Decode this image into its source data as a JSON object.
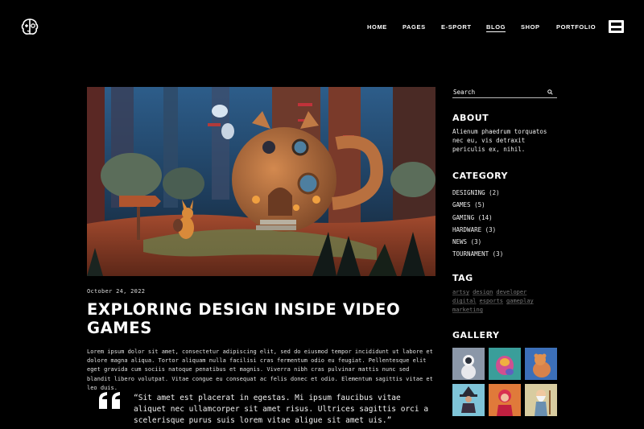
{
  "header": {
    "logo_icon": "brain-icon",
    "nav": [
      {
        "label": "HOME"
      },
      {
        "label": "PAGES"
      },
      {
        "label": "E-SPORT"
      },
      {
        "label": "BLOG",
        "active": true
      },
      {
        "label": "SHOP"
      },
      {
        "label": "PORTFOLIO"
      }
    ],
    "menu_icon": "hamburger-menu-icon"
  },
  "post": {
    "image_icon": "cartoon-fox-house-scene",
    "date": "October 24, 2022",
    "title": "EXPLORING DESIGN INSIDE VIDEO GAMES",
    "body": "Lorem ipsum dolor sit amet, consectetur adipiscing elit, sed do eiusmod tempor incididunt ut labore et dolore magna aliqua. Tortor aliquam nulla facilisi cras fermentum odio eu feugiat. Pellentesque elit eget gravida cum sociis natoque penatibus et magnis. Viverra nibh cras pulvinar mattis nunc sed blandit libero volutpat. Vitae congue eu consequat ac felis donec et odio. Elementum sagittis vitae et leo duis.",
    "quote": "“Sit amet est placerat in egestas. Mi ipsum faucibus vitae aliquet nec ullamcorper sit amet risus. Ultrices sagittis orci a scelerisque purus suis lorem vitae aligue sit amet uis.”"
  },
  "sidebar": {
    "search": {
      "placeholder": "Search",
      "icon": "search-icon"
    },
    "about": {
      "heading": "ABOUT",
      "text": "Alienum phaedrum torquatos nec eu, vis detraxit periculis ex, nihil."
    },
    "category": {
      "heading": "CATEGORY",
      "items": [
        {
          "name": "DESIGNING",
          "count": "(2)"
        },
        {
          "name": "GAMES",
          "count": "(5)"
        },
        {
          "name": "GAMING",
          "count": "(14)"
        },
        {
          "name": "HARDWARE",
          "count": "(3)"
        },
        {
          "name": "NEWS",
          "count": "(3)"
        },
        {
          "name": "TOURNAMENT",
          "count": "(3)"
        }
      ]
    },
    "tag": {
      "heading": "TAG",
      "items": [
        "artsy",
        "design",
        "developer",
        "digital",
        "esports",
        "gameplay",
        "marketing"
      ]
    },
    "gallery": {
      "heading": "GALLERY",
      "items": [
        "astronaut-figure",
        "colorful-creature",
        "blue-bear",
        "witch-figure",
        "pink-character",
        "wizard-old-man"
      ]
    }
  },
  "colors": {
    "background": "#000000",
    "text": "#ffffff",
    "tag_text": "#7a7a7a"
  }
}
